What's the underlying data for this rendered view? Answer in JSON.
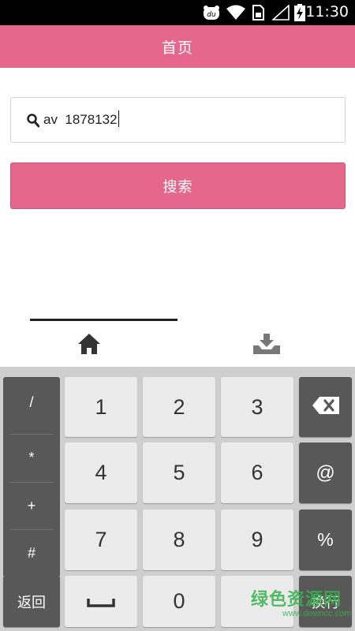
{
  "status_bar": {
    "time": "11:30",
    "icons": [
      "baidu-notification-icon",
      "wifi-icon",
      "sim-card-icon",
      "signal-icon",
      "battery-charging-icon"
    ]
  },
  "header": {
    "title": "首页"
  },
  "search": {
    "value": "av  1878132",
    "icon": "search-icon",
    "button_label": "搜索"
  },
  "tabs": [
    {
      "icon": "home-icon",
      "selected": true
    },
    {
      "icon": "download-tray-icon",
      "selected": false
    }
  ],
  "keyboard": {
    "symbols": [
      "/",
      "*",
      "+",
      "#"
    ],
    "digits": [
      "1",
      "2",
      "3",
      "4",
      "5",
      "6",
      "7",
      "8",
      "9",
      "0"
    ],
    "right_keys": {
      "backspace_icon": "backspace-icon",
      "at": "@",
      "percent": "%"
    },
    "back_label": "返回",
    "space_icon": "space-icon",
    "enter_label": "换行"
  },
  "watermark": {
    "text": "绿色资源网",
    "url": "www.downcc.com"
  },
  "colors": {
    "accent": "#e5688c",
    "keyboard_dark": "#585858",
    "keyboard_light": "#ebebeb",
    "keyboard_bg": "#cfcfcf"
  }
}
